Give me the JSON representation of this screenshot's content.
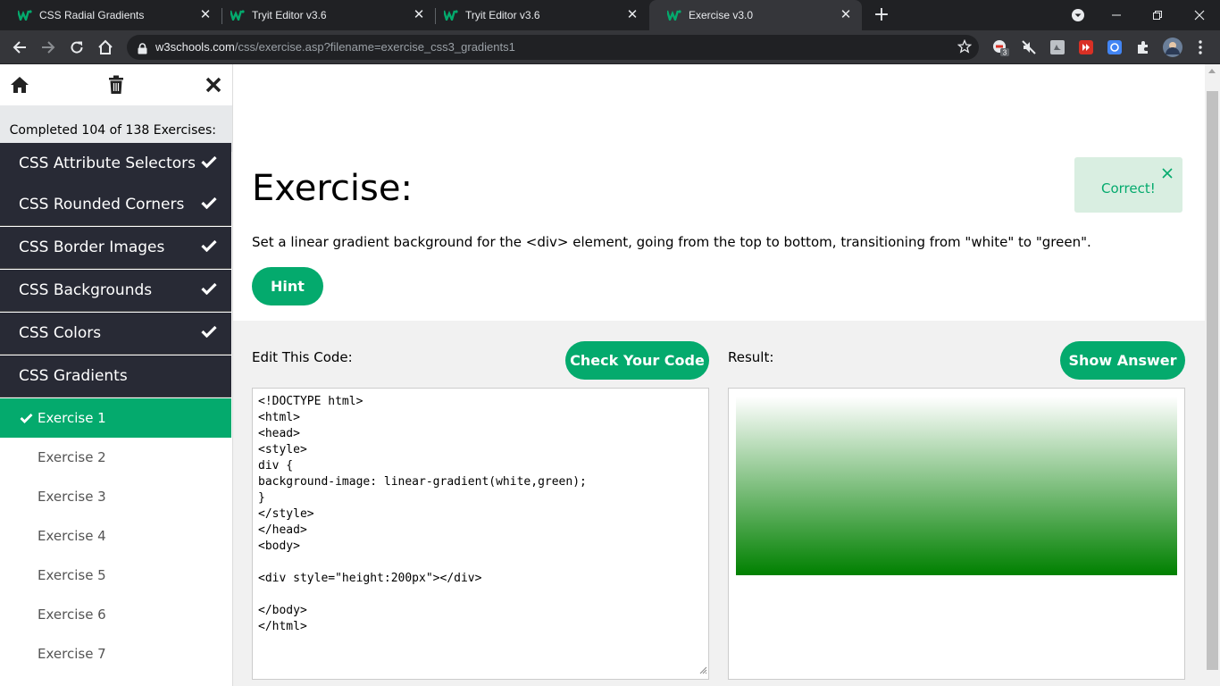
{
  "browser": {
    "tabs": [
      {
        "title": "CSS Radial Gradients",
        "active": false,
        "favicon": "w3schools-icon"
      },
      {
        "title": "Tryit Editor v3.6",
        "active": false,
        "favicon": "w3schools-icon"
      },
      {
        "title": "Tryit Editor v3.6",
        "active": false,
        "favicon": "w3schools-icon"
      },
      {
        "title": "Exercise v3.0",
        "active": true,
        "favicon": "w3schools-icon"
      }
    ],
    "url_host": "w3schools.com",
    "url_path": "/css/exercise.asp?filename=exercise_css3_gradients1",
    "extension_badge": "3"
  },
  "sidebar": {
    "progress_text": "Completed 104 of 138 Exercises:",
    "topics": [
      {
        "label": "CSS Attribute Selectors",
        "done": true
      },
      {
        "label": "CSS Rounded Corners",
        "done": true
      },
      {
        "label": "CSS Border Images",
        "done": true
      },
      {
        "label": "CSS Backgrounds",
        "done": true
      },
      {
        "label": "CSS Colors",
        "done": true
      },
      {
        "label": "CSS Gradients",
        "done": false
      }
    ],
    "exercises": [
      {
        "label": "Exercise 1",
        "active": true,
        "done": true
      },
      {
        "label": "Exercise 2",
        "active": false,
        "done": false
      },
      {
        "label": "Exercise 3",
        "active": false,
        "done": false
      },
      {
        "label": "Exercise 4",
        "active": false,
        "done": false
      },
      {
        "label": "Exercise 5",
        "active": false,
        "done": false
      },
      {
        "label": "Exercise 6",
        "active": false,
        "done": false
      },
      {
        "label": "Exercise 7",
        "active": false,
        "done": false
      }
    ]
  },
  "main": {
    "title": "Exercise:",
    "correct_text": "Correct!",
    "instruction": "Set a linear gradient background for the <div> element, going from the top to bottom, transitioning from \"white\" to \"green\".",
    "hint_label": "Hint",
    "edit_label": "Edit This Code:",
    "check_label": "Check Your Code",
    "result_label": "Result:",
    "answer_label": "Show Answer",
    "code_lines": [
      "<!DOCTYPE html>",
      "<html>",
      "<head>",
      "<style>",
      "div {",
      "background-image: linear-gradient(white,green);",
      "}",
      "</style>",
      "</head>",
      "<body>",
      "",
      "<div style=\"height:200px\"></div>",
      "",
      "</body>",
      "</html>"
    ],
    "gradient_from": "white",
    "gradient_to": "green"
  },
  "colors": {
    "accent": "#04aa6d",
    "sidebar_dark": "#282a35",
    "chrome_dark": "#202124",
    "chrome_mid": "#35363a"
  }
}
